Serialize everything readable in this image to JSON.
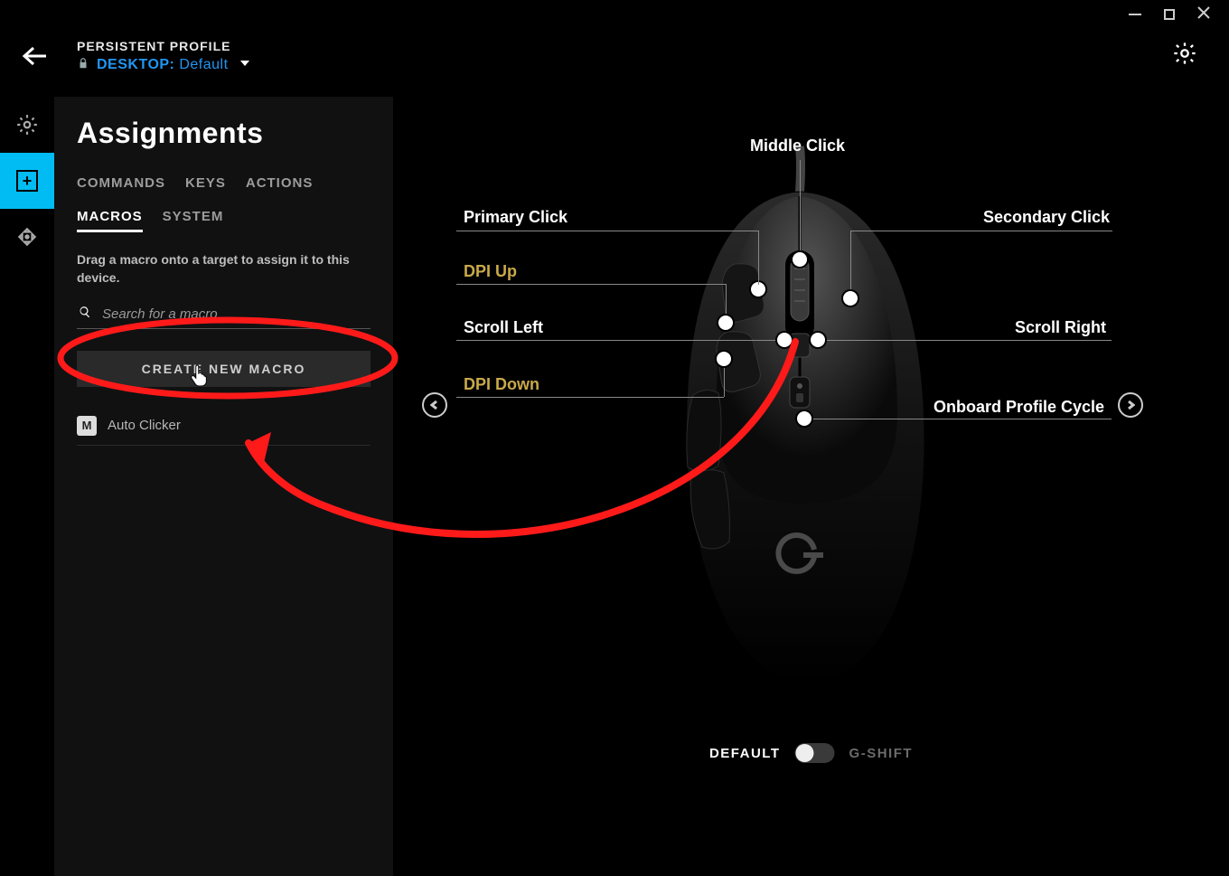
{
  "header": {
    "profile_label": "PERSISTENT PROFILE",
    "profile_prefix": "DESKTOP:",
    "profile_value": " Default"
  },
  "panel": {
    "title": "Assignments",
    "tabs": [
      "COMMANDS",
      "KEYS",
      "ACTIONS",
      "MACROS",
      "SYSTEM"
    ],
    "active_tab_index": 3,
    "hint": "Drag a macro onto a target to assign it to this device.",
    "search_placeholder": "Search for a macro",
    "create_label": "CREATE NEW MACRO",
    "macros": [
      {
        "badge": "M",
        "name": "Auto Clicker"
      }
    ]
  },
  "mouse_labels": {
    "middle": "Middle Click",
    "primary": "Primary Click",
    "secondary": "Secondary Click",
    "dpi_up": "DPI Up",
    "dpi_down": "DPI Down",
    "scroll_left": "Scroll Left",
    "scroll_right": "Scroll Right",
    "profile_cycle": "Onboard Profile Cycle"
  },
  "mode": {
    "default": "DEFAULT",
    "gshift": "G-SHIFT"
  },
  "annotation_color": "#ff1a1a"
}
